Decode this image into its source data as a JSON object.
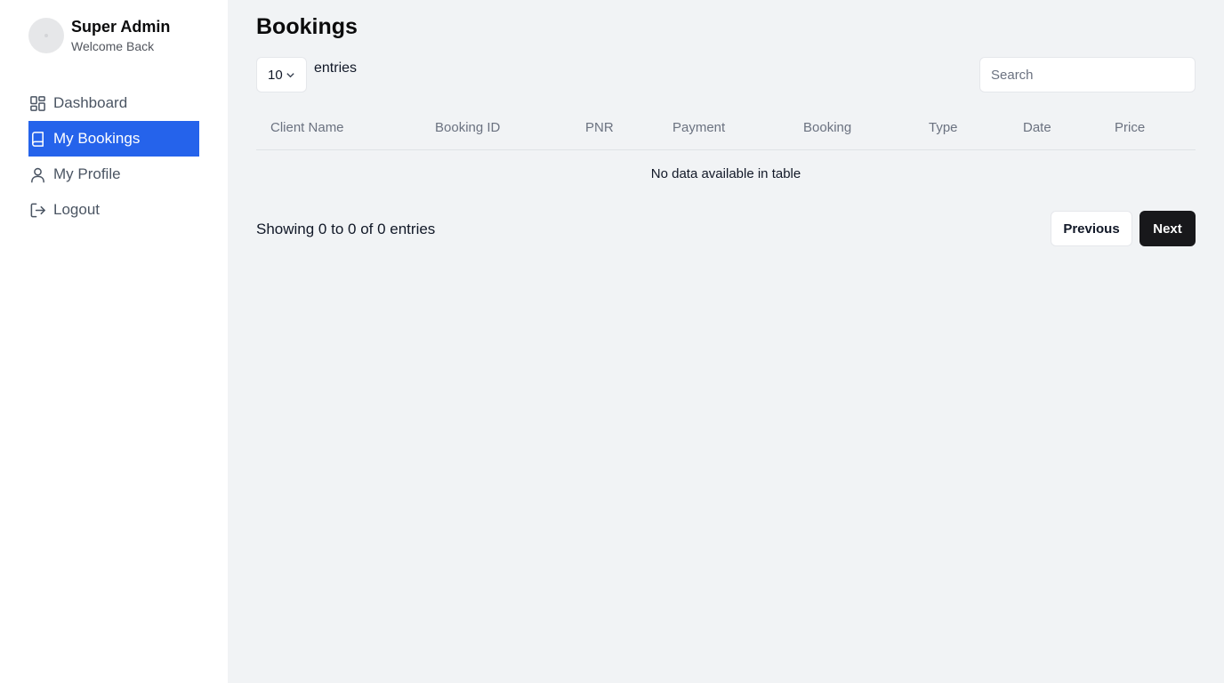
{
  "user": {
    "name": "Super Admin",
    "subtitle": "Welcome Back"
  },
  "nav": {
    "items": [
      {
        "label": "Dashboard",
        "icon": "dashboard-icon",
        "active": false
      },
      {
        "label": "My Bookings",
        "icon": "book-icon",
        "active": true
      },
      {
        "label": "My Profile",
        "icon": "user-icon",
        "active": false
      },
      {
        "label": "Logout",
        "icon": "logout-icon",
        "active": false
      }
    ]
  },
  "page": {
    "title": "Bookings"
  },
  "controls": {
    "page_length": "10",
    "entries_label": "entries",
    "search_placeholder": "Search"
  },
  "table": {
    "columns": [
      "Client Name",
      "Booking ID",
      "PNR",
      "Payment",
      "Booking",
      "Type",
      "Date",
      "Price"
    ],
    "empty_message": "No data available in table"
  },
  "footer": {
    "info": "Showing 0 to 0 of 0 entries",
    "previous_label": "Previous",
    "next_label": "Next"
  },
  "colors": {
    "accent": "#2563eb",
    "background": "#f1f3f5",
    "next_button": "#18181b"
  }
}
